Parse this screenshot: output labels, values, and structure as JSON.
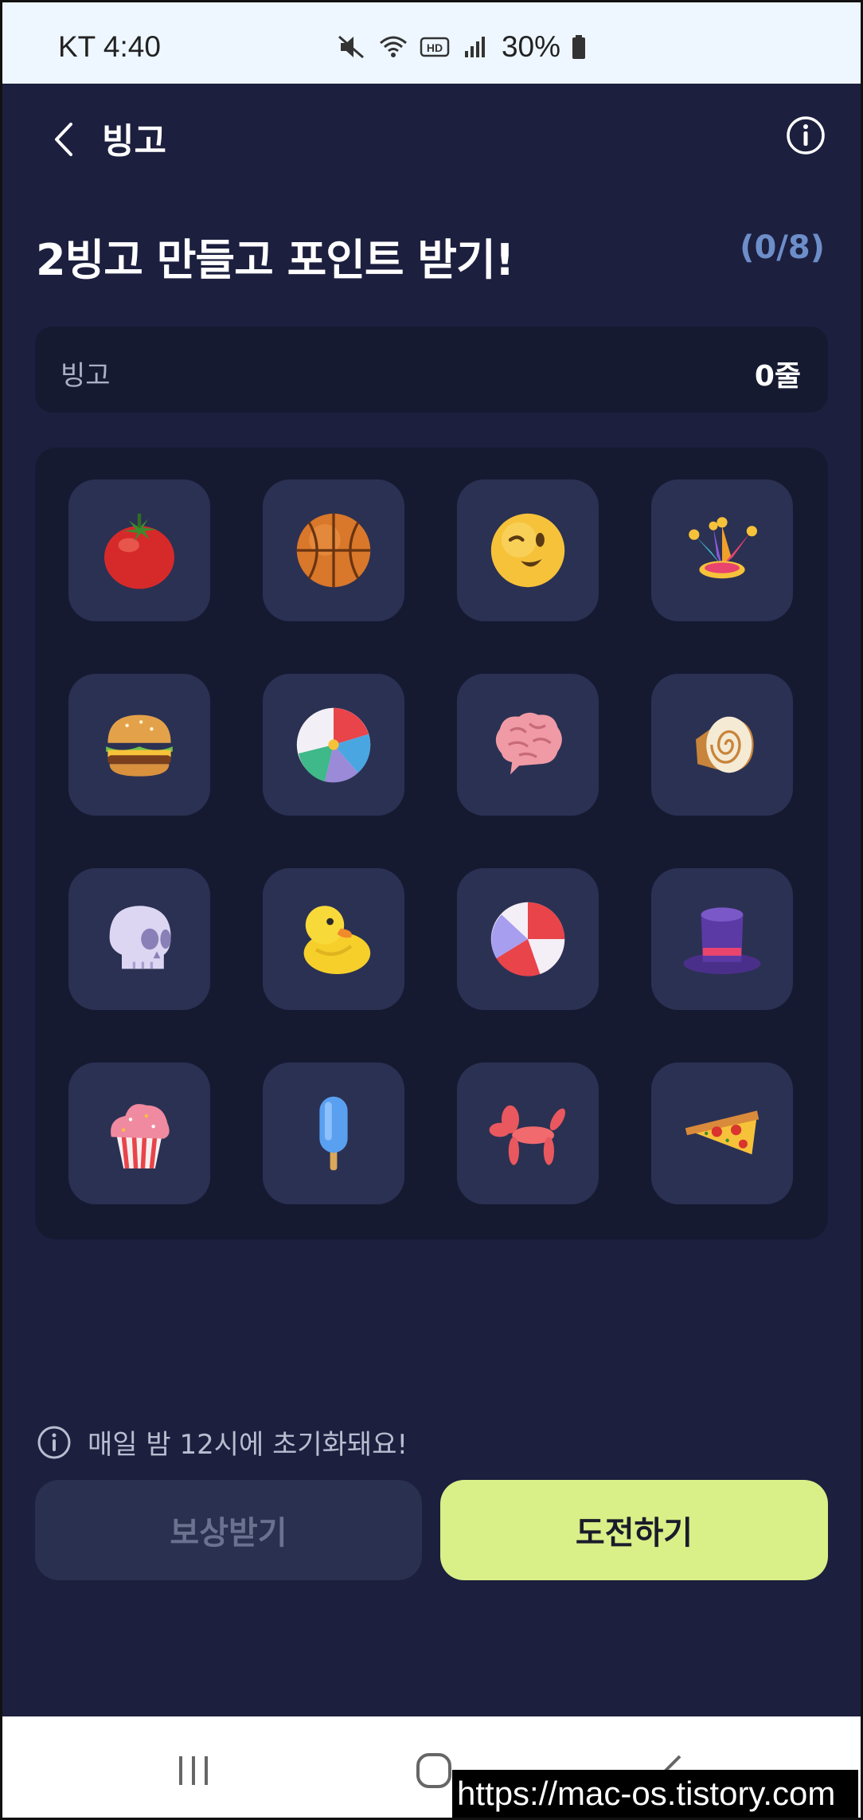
{
  "status_bar": {
    "carrier_time": "KT 4:40",
    "battery": "30%",
    "icons": [
      "mute-icon",
      "wifi-icon",
      "hd-icon",
      "signal-icon",
      "battery-icon"
    ]
  },
  "header": {
    "title": "빙고",
    "back_icon": "chevron-left-icon",
    "info_icon": "info-icon"
  },
  "heading": {
    "title": "2빙고 만들고 포인트 받기!",
    "progress": "(0/8)"
  },
  "bingo_lines": {
    "label": "빙고",
    "value": "0줄"
  },
  "board": {
    "cells": [
      "tomato-icon",
      "basketball-icon",
      "winking-face-icon",
      "jester-hat-icon",
      "hamburger-icon",
      "beach-ball-icon",
      "brain-icon",
      "roll-cake-icon",
      "skull-icon",
      "rubber-duck-icon",
      "striped-ball-icon",
      "top-hat-icon",
      "cupcake-icon",
      "popsicle-icon",
      "balloon-dog-icon",
      "pizza-slice-icon"
    ]
  },
  "notice": {
    "text": "매일 밤 12시에 초기화돼요!"
  },
  "buttons": {
    "reward_label": "보상받기",
    "challenge_label": "도전하기"
  },
  "colors": {
    "background": "#1c1f3e",
    "accent": "#d9ef88",
    "progress": "#6d8ec9"
  },
  "watermark": "https://mac-os.tistory.com"
}
